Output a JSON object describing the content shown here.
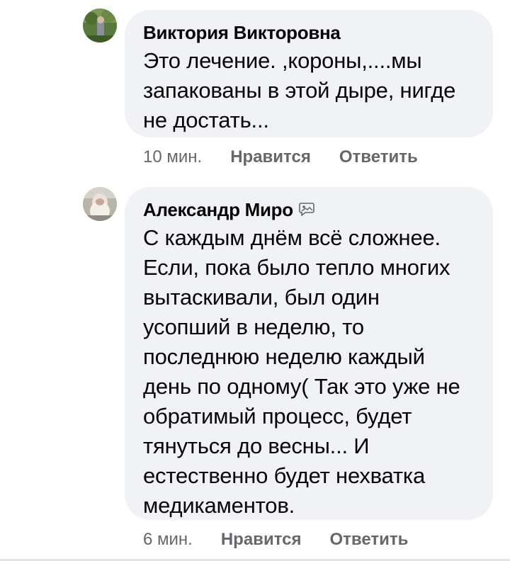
{
  "comments": [
    {
      "author": "Виктория Викторовна",
      "text": "Это лечение. ,короны,....мы\nзапакованы в этой дыре, нигде\nне достать...",
      "time": "10 мин.",
      "like_label": "Нравится",
      "reply_label": "Ответить",
      "avatar_icon": "user-avatar-photo"
    },
    {
      "author": "Александр Миро",
      "author_badge_icon": "message-image-icon",
      "text": "С каждым днём всё сложнее.\nЕсли, пока было тепло многих\nвытаскивали, был один\nусопший в неделю, то\nпоследнюю неделю каждый\nдень по одному( Так это уже не\nобратимый процесс, будет\nтянуться до весны... И\nестественно будет нехватка\nмедикаментов.",
      "time": "6 мин.",
      "like_label": "Нравится",
      "reply_label": "Ответить",
      "avatar_icon": "user-avatar-photo"
    }
  ],
  "colors": {
    "bubble_bg": "#f0f2f5",
    "text": "#050505",
    "secondary_text": "#65676b"
  }
}
